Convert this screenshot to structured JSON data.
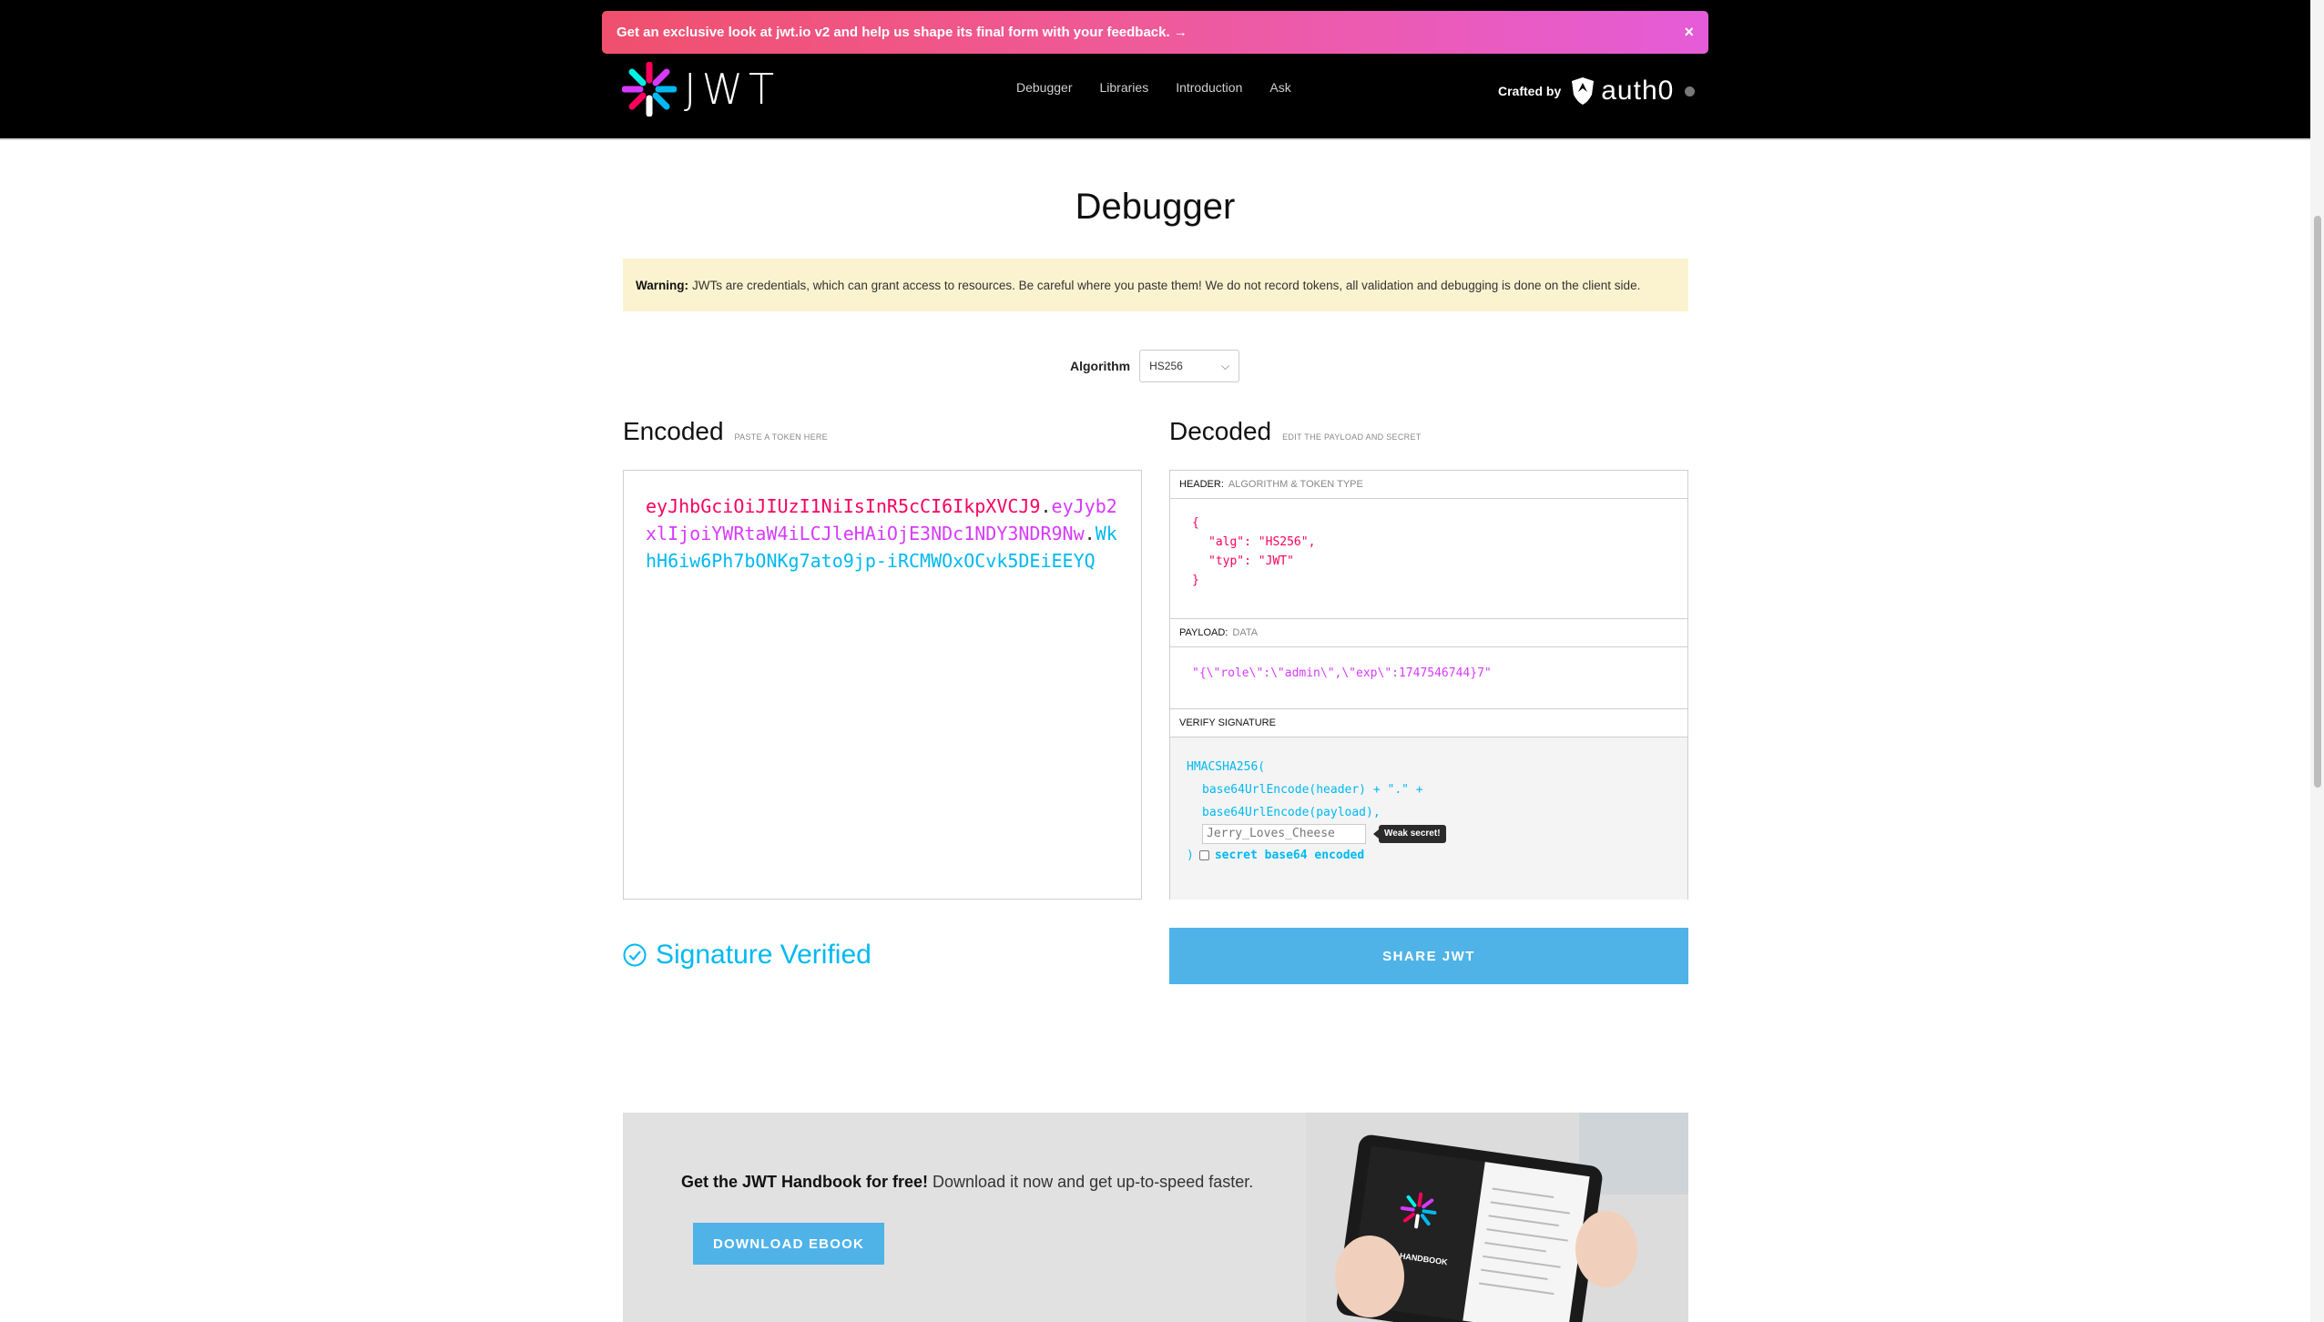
{
  "promo": {
    "text": "Get an exclusive look at jwt.io v2 and help us shape its final form with your feedback.  →",
    "close": "×"
  },
  "header": {
    "logo_text": "JWT",
    "nav": [
      "Debugger",
      "Libraries",
      "Introduction",
      "Ask"
    ],
    "crafted_by": "Crafted by",
    "brand": "auth0"
  },
  "page": {
    "title": "Debugger"
  },
  "warning": {
    "label": "Warning:",
    "text": "JWTs are credentials, which can grant access to resources. Be careful where you paste them! We do not record tokens, all validation and debugging is done on the client side."
  },
  "algorithm": {
    "label": "Algorithm",
    "value": "HS256"
  },
  "encoded": {
    "title": "Encoded",
    "subtitle": "PASTE A TOKEN HERE",
    "header_part": "eyJhbGciOiJIUzI1NiIsInR5cCI6IkpXVCJ9",
    "payload_part": "eyJyb2xlIjoiYWRtaW4iLCJleHAiOjE3NDc1NDY3NDR9Nw",
    "signature_part": "WkhH6iw6Ph7bONKg7ato9jp-iRCMWOxOCvk5DEiEEYQ",
    "dot": "."
  },
  "decoded": {
    "title": "Decoded",
    "subtitle": "EDIT THE PAYLOAD AND SECRET",
    "header_section": {
      "label": "HEADER:",
      "sublabel": "ALGORITHM & TOKEN TYPE"
    },
    "header_json": {
      "open": "{",
      "alg_line": "\"alg\": \"HS256\",",
      "typ_line": "\"typ\": \"JWT\"",
      "close": "}"
    },
    "payload_section": {
      "label": "PAYLOAD:",
      "sublabel": "DATA"
    },
    "payload_text": "\"{\\\"role\\\":\\\"admin\\\",\\\"exp\\\":1747546744}7\"",
    "verify_section": {
      "label": "VERIFY SIGNATURE"
    },
    "signature": {
      "fn": "HMACSHA256(",
      "line1": "base64UrlEncode(header) + \".\" +",
      "line2": "base64UrlEncode(payload),",
      "secret": "Jerry_Loves_Cheese",
      "weak_tip": "Weak secret!",
      "close": ")",
      "b64_label": "secret base64 encoded"
    }
  },
  "status": {
    "verified": "Signature Verified"
  },
  "share": {
    "label": "SHARE JWT"
  },
  "ebook": {
    "title": "Get the JWT Handbook for free!",
    "text": "Download it now and get up-to-speed faster.",
    "button": "DOWNLOAD EBOOK",
    "book_label": "JWT HANDBOOK"
  },
  "colors": {
    "header_token": "#fb015b",
    "payload_token": "#d63aff",
    "signature_token": "#00b9f1",
    "accent": "#4fb3e8"
  }
}
